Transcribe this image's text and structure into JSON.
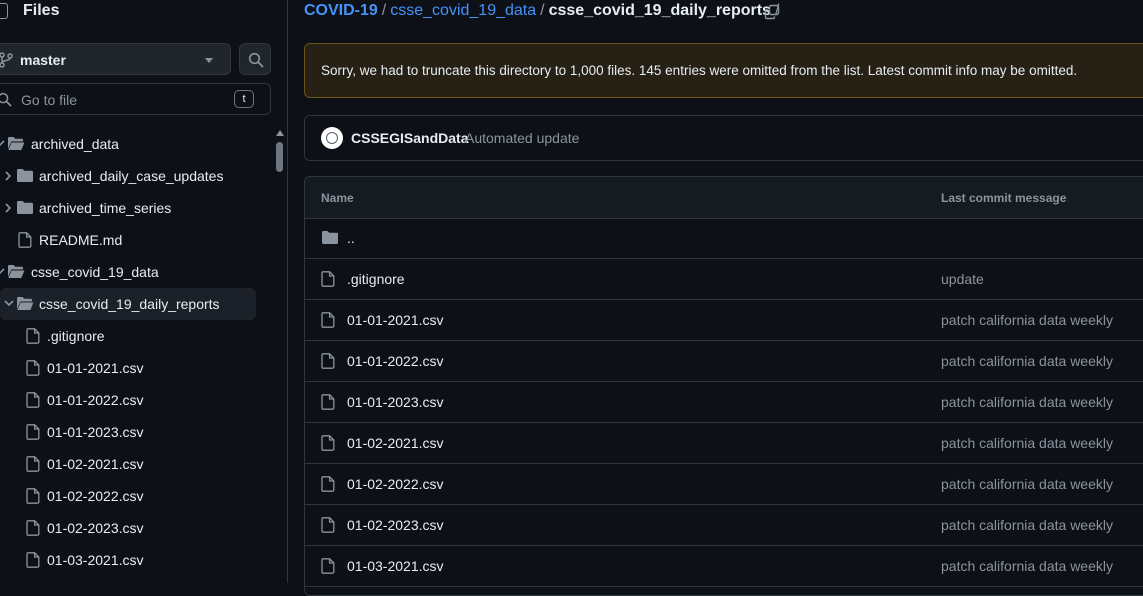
{
  "sidebar": {
    "title": "Files",
    "branch": "master",
    "goto_placeholder": "Go to file",
    "goto_shortcut": "t",
    "tree": [
      {
        "label": "archived_data",
        "type": "folder-open",
        "depth": 0
      },
      {
        "label": "archived_daily_case_updates",
        "type": "folder",
        "depth": 1
      },
      {
        "label": "archived_time_series",
        "type": "folder",
        "depth": 1
      },
      {
        "label": "README.md",
        "type": "file",
        "depth": 1
      },
      {
        "label": "csse_covid_19_data",
        "type": "folder-open",
        "depth": 0
      },
      {
        "label": "csse_covid_19_daily_reports",
        "type": "folder-open",
        "depth": 1,
        "selected": true
      },
      {
        "label": ".gitignore",
        "type": "file",
        "depth": 2
      },
      {
        "label": "01-01-2021.csv",
        "type": "file",
        "depth": 2
      },
      {
        "label": "01-01-2022.csv",
        "type": "file",
        "depth": 2
      },
      {
        "label": "01-01-2023.csv",
        "type": "file",
        "depth": 2
      },
      {
        "label": "01-02-2021.csv",
        "type": "file",
        "depth": 2
      },
      {
        "label": "01-02-2022.csv",
        "type": "file",
        "depth": 2
      },
      {
        "label": "01-02-2023.csv",
        "type": "file",
        "depth": 2
      },
      {
        "label": "01-03-2021.csv",
        "type": "file",
        "depth": 2
      }
    ]
  },
  "breadcrumb": {
    "repo": "COVID-19",
    "parent": "csse_covid_19_data",
    "current": "csse_covid_19_daily_reports",
    "sep": "/"
  },
  "banner": {
    "text": "Sorry, we had to truncate this directory to 1,000 files. 145 entries were omitted from the list. Latest commit info may be omitted."
  },
  "commit": {
    "author": "CSSEGISandData",
    "message": "Automated update"
  },
  "table": {
    "col_name": "Name",
    "col_message": "Last commit message",
    "rows": [
      {
        "name": "..",
        "type": "folder",
        "message": ""
      },
      {
        "name": ".gitignore",
        "type": "file",
        "message": "update"
      },
      {
        "name": "01-01-2021.csv",
        "type": "file",
        "message": "patch california data weekly"
      },
      {
        "name": "01-01-2022.csv",
        "type": "file",
        "message": "patch california data weekly"
      },
      {
        "name": "01-01-2023.csv",
        "type": "file",
        "message": "patch california data weekly"
      },
      {
        "name": "01-02-2021.csv",
        "type": "file",
        "message": "patch california data weekly"
      },
      {
        "name": "01-02-2022.csv",
        "type": "file",
        "message": "patch california data weekly"
      },
      {
        "name": "01-02-2023.csv",
        "type": "file",
        "message": "patch california data weekly"
      },
      {
        "name": "01-03-2021.csv",
        "type": "file",
        "message": "patch california data weekly"
      }
    ]
  },
  "colors": {
    "background": "#0d1117",
    "link": "#4493f8",
    "muted": "#8b949e",
    "border": "#30363d",
    "warning_bg": "#272115",
    "warning_border": "#6b5418"
  }
}
